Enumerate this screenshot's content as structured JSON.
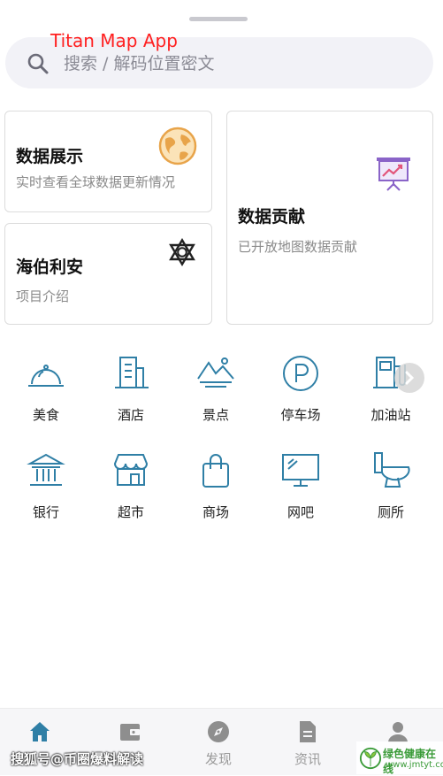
{
  "app": {
    "title": "Titan Map App"
  },
  "search": {
    "placeholder": "搜索 / 解码位置密文"
  },
  "cards": {
    "data_display": {
      "title": "数据展示",
      "subtitle": "实时查看全球数据更新情况"
    },
    "data_contribution": {
      "title": "数据贡献",
      "subtitle": "已开放地图数据贡献"
    },
    "hyperion": {
      "title": "海伯利安",
      "subtitle": "项目介绍"
    }
  },
  "categories": [
    {
      "label": "美食",
      "icon": "food-cloche-icon"
    },
    {
      "label": "酒店",
      "icon": "hotel-building-icon"
    },
    {
      "label": "景点",
      "icon": "scenic-mountain-icon"
    },
    {
      "label": "停车场",
      "icon": "parking-icon"
    },
    {
      "label": "加油站",
      "icon": "gas-station-icon"
    },
    {
      "label": "银行",
      "icon": "bank-icon"
    },
    {
      "label": "超市",
      "icon": "supermarket-icon"
    },
    {
      "label": "商场",
      "icon": "shopping-bag-icon"
    },
    {
      "label": "网吧",
      "icon": "computer-monitor-icon"
    },
    {
      "label": "厕所",
      "icon": "toilet-icon"
    }
  ],
  "tabs": [
    {
      "label": "",
      "icon": "home-icon",
      "active": true
    },
    {
      "label": "",
      "icon": "wallet-icon",
      "active": false
    },
    {
      "label": "发现",
      "icon": "compass-icon",
      "active": false
    },
    {
      "label": "资讯",
      "icon": "document-icon",
      "active": false
    },
    {
      "label": "",
      "icon": "user-icon",
      "active": false
    }
  ],
  "watermark": {
    "left": "搜狐号@币圈爆料解读",
    "right_title": "绿色健康在线",
    "right_url": "www.jmtyt.com"
  },
  "colors": {
    "icon_teal": "#2f7fa6",
    "title_red": "#ff1f1f",
    "globe_orange": "#e8a44a",
    "chart_purple": "#8a64c8"
  }
}
